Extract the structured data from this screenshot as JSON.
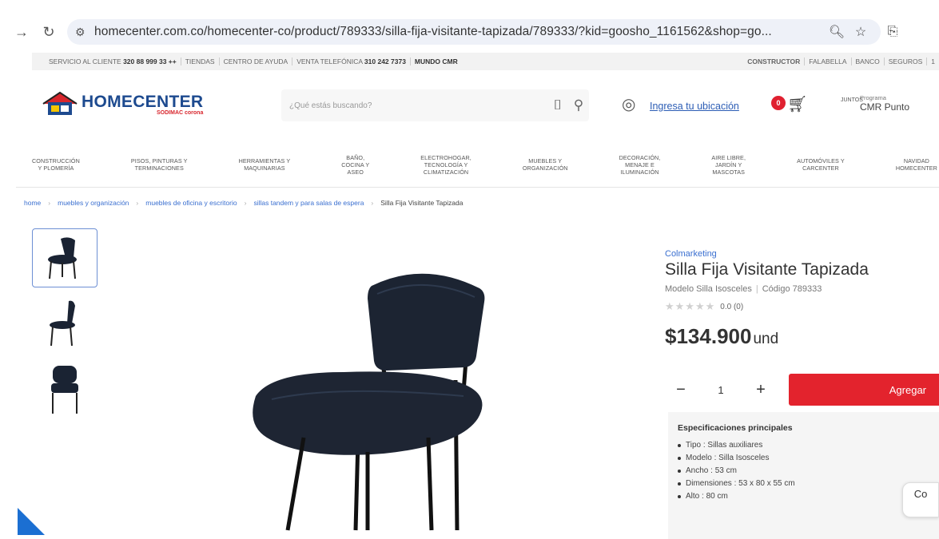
{
  "browser": {
    "url": "homecenter.com.co/homecenter-co/product/789333/silla-fija-visitante-tapizada/789333/?kid=goosho_1161562&shop=go..."
  },
  "topbar": {
    "left": [
      {
        "label": "SERVICIO AL CLIENTE",
        "value": "320 88 999 33 ++"
      },
      {
        "label": "TIENDAS",
        "value": ""
      },
      {
        "label": "CENTRO DE AYUDA",
        "value": ""
      },
      {
        "label": "VENTA TELEFÓNICA",
        "value": "310 242 7373"
      },
      {
        "label": "",
        "value": "MUNDO CMR"
      }
    ],
    "right": [
      "CONSTRUCTOR",
      "FALABELLA",
      "BANCO",
      "SEGUROS",
      "1"
    ]
  },
  "header": {
    "logo_main": "HOMECENTER",
    "logo_sub": "SODIMAC corona",
    "search_placeholder": "¿Qué estás buscando?",
    "location_link": "Ingresa tu ubicación",
    "cart_count": "0",
    "cmr_logo": "JUNTOS",
    "cmr_small": "Programa",
    "cmr_big": "CMR Punto"
  },
  "categories": [
    [
      "CONSTRUCCIÓN",
      "Y PLOMERÍA"
    ],
    [
      "PISOS, PINTURAS Y",
      "TERMINACIONES"
    ],
    [
      "HERRAMIENTAS Y",
      "MAQUINARIAS"
    ],
    [
      "BAÑO,",
      "COCINA Y",
      "ASEO"
    ],
    [
      "ELECTROHOGAR,",
      "TECNOLOGÍA Y",
      "CLIMATIZACIÓN"
    ],
    [
      "MUEBLES Y",
      "ORGANIZACIÓN"
    ],
    [
      "DECORACIÓN,",
      "MENAJE E",
      "ILUMINACIÓN"
    ],
    [
      "AIRE LIBRE,",
      "JARDÍN Y",
      "MASCOTAS"
    ],
    [
      "AUTOMÓVILES Y",
      "CARCENTER"
    ],
    [
      "NAVIDAD",
      "HOMECENTER"
    ]
  ],
  "breadcrumb": [
    "home",
    "muebles y organización",
    "muebles de oficina y escritorio",
    "sillas tandem y para salas de espera",
    "Silla Fija Visitante Tapizada"
  ],
  "product": {
    "brand": "Colmarketing",
    "title": "Silla Fija Visitante Tapizada",
    "model": "Modelo Silla Isosceles",
    "code": "Código 789333",
    "rating_text": "0.0 (0)",
    "rating": 0,
    "price": "$134.900",
    "unit": "und",
    "quantity": "1",
    "add_label": "Agregar"
  },
  "specs": {
    "heading": "Especificaciones principales",
    "items": [
      "Tipo : Sillas auxiliares",
      "Modelo : Silla Isosceles",
      "Ancho : 53 cm",
      "Dimensiones : 53 x 80 x 55 cm",
      "Alto : 80 cm"
    ]
  },
  "chat_label": "Co",
  "colors": {
    "accent_red": "#e3232d",
    "link_blue": "#3a6fd0",
    "logo_blue": "#1d4a8f"
  }
}
